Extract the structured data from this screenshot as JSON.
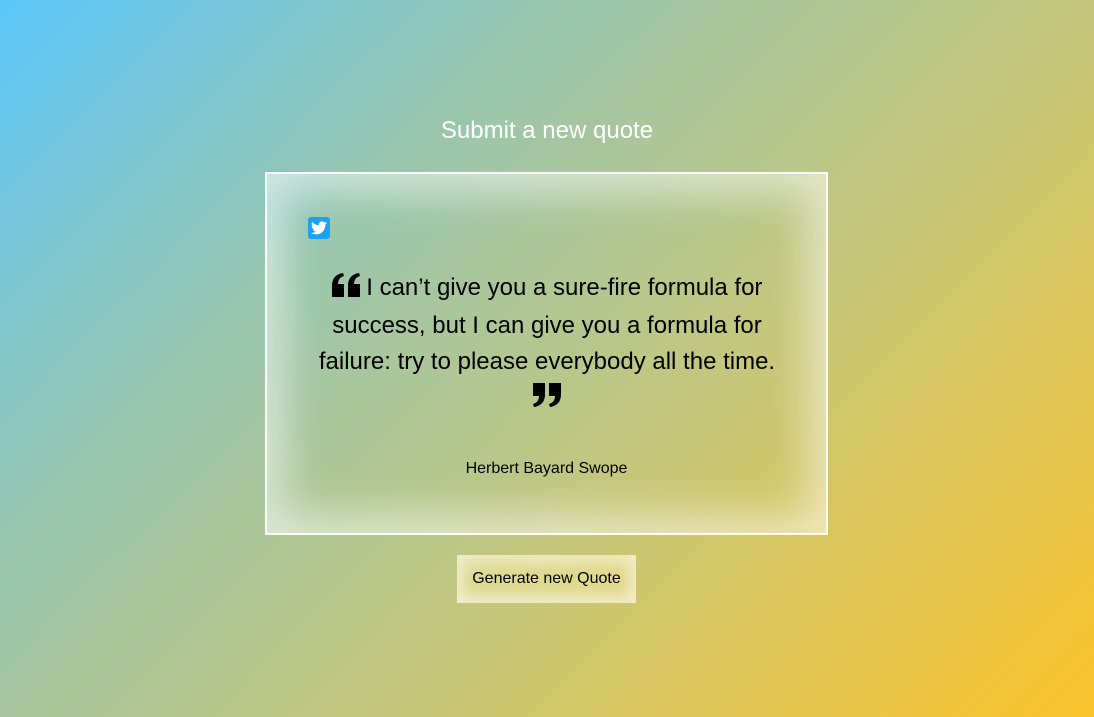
{
  "header": {
    "submit_label": "Submit a new quote"
  },
  "quote_card": {
    "share_icon": "twitter-icon",
    "open_quote_icon": "quote-left-icon",
    "close_quote_icon": "quote-right-icon",
    "text": "I can’t give you a sure-fire formula for success, but I can give you a formula for failure: try to please everybody all the time.",
    "author": "Herbert Bayard Swope"
  },
  "actions": {
    "generate_label": "Generate new Quote"
  },
  "colors": {
    "twitter_blue": "#1da1f2",
    "gradient_start": "#5bc6fb",
    "gradient_end": "#f9c22a"
  }
}
